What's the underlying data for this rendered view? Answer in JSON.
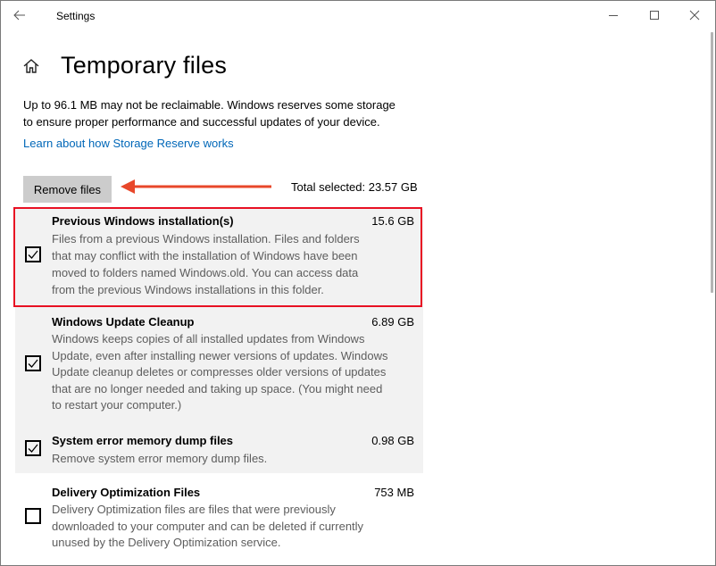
{
  "window": {
    "title": "Settings",
    "back_icon": "back-arrow-icon",
    "min_icon": "minimize-icon",
    "max_icon": "maximize-icon",
    "close_icon": "close-icon"
  },
  "page": {
    "home_icon": "home-icon",
    "title": "Temporary files",
    "info_line1": "Up to 96.1 MB may not be reclaimable. Windows reserves some storage",
    "info_line2": "to ensure proper performance and successful updates of your device.",
    "learn_link": "Learn about how Storage Reserve works"
  },
  "actions": {
    "remove_button": "Remove files",
    "total_selected": "Total selected: 23.57 GB",
    "arrow_color": "#e8472a"
  },
  "items": [
    {
      "name": "Previous Windows installation(s)",
      "size": "15.6 GB",
      "checked": true,
      "desc_lines": [
        "Files from a previous Windows installation.  Files and folders",
        "that may conflict with the installation of Windows have been",
        "moved to folders named Windows.old.  You can access data",
        "from the previous Windows installations in this folder."
      ]
    },
    {
      "name": "Windows Update Cleanup",
      "size": "6.89 GB",
      "checked": true,
      "desc_lines": [
        "Windows keeps copies of all installed updates from Windows",
        "Update, even after installing newer versions of updates. Windows",
        "Update cleanup deletes or compresses older versions of updates",
        "that are no longer needed and taking up space. (You might need",
        "to restart your computer.)"
      ]
    },
    {
      "name": "System error memory dump files",
      "size": "0.98 GB",
      "checked": true,
      "desc_lines": [
        "Remove system error memory dump files."
      ]
    },
    {
      "name": "Delivery Optimization Files",
      "size": "753 MB",
      "checked": false,
      "desc_lines": [
        "Delivery Optimization files are files that were previously",
        "downloaded to your computer and can be deleted if currently",
        "unused by the Delivery Optimization service."
      ]
    }
  ],
  "colors": {
    "link": "#0067b8",
    "highlight_border": "#e81123",
    "selected_bg": "#f2f2f2",
    "button_bg": "#cccccc"
  }
}
